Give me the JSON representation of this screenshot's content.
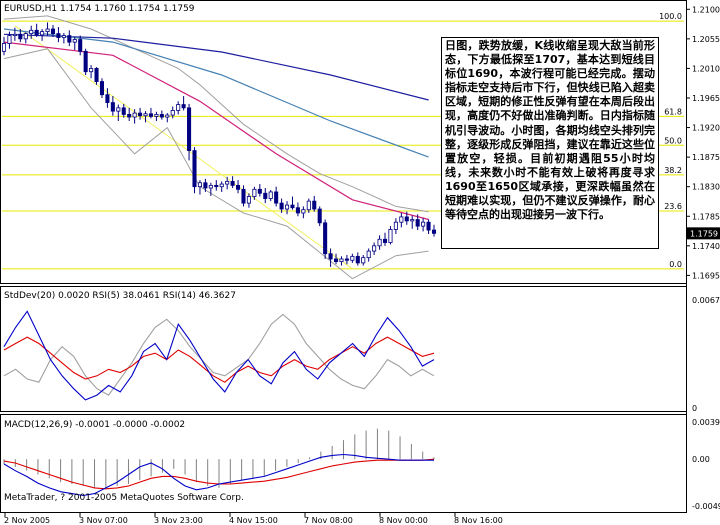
{
  "window": {
    "title": "EURUSD,H1  1.1754 1.1760 1.1754 1.1759",
    "copyright": "MetaTrader, ? 2001-2005 MetaQuotes Software Corp."
  },
  "colors": {
    "background": "#FFFFFF",
    "candle": "#000080",
    "ma_blue": "#1E1EA0",
    "ma_steel": "#4682B4",
    "ma_magenta": "#D0207A",
    "bollinger": "#A0A0A0",
    "fib": "#E8E800",
    "trendline": "#F0F060",
    "rsi5": "#0000C8",
    "rsi14": "#E00000",
    "macd_line": "#0000C8",
    "signal_line": "#E00000",
    "histogram": "#808080",
    "price_tag_bg": "#000000",
    "price_tag_fg": "#FFFFFF"
  },
  "commentary": "日图，跌势放缓，K线收缩呈现大敌当前形态，下方最低探至1707，基本达到短线目标位1690，本波行程可能已经完成。摆动指标走空支持后市下行，但快线已陷入超卖区域，短期的修正性反弹有望在本周后段出现，高度仍不好做出准确判断。日内指标随机引导波动。小时图，各期均线空头排列完整，逐级形成反弹阻挡，建议在靠近这些位置放空，轻损。目前初期遇阻55小时均线，未来数小时不能有效上破将再度寻求1690至1650区域承接，更深跌幅虽然在短期难以实现，但仍不建议反弹操作，耐心等待空点的出现迎接另一波下行。",
  "indicator_labels": {
    "stddev_rsi": "StdDev(20) 0.0020  RSI(5) 38.0461  RSI(14) 46.3627",
    "macd": "MACD(12,26,9) -0.0001 -0.0000 -0.0002"
  },
  "chart_data": {
    "type": "candlestick",
    "symbol": "EURUSD",
    "timeframe": "H1",
    "x_tick_labels": [
      "2 Nov 2005",
      "3 Nov 07:00",
      "3 Nov 23:00",
      "4 Nov 15:00",
      "7 Nov 08:00",
      "8 Nov 00:00",
      "8 Nov 16:00"
    ],
    "price_axis": {
      "ticks": [
        "1.2100",
        "1.2055",
        "1.2010",
        "1.1965",
        "1.1920",
        "1.1875",
        "1.1830",
        "1.1785",
        "1.1740",
        "1.1695"
      ],
      "ylim": [
        1.1688,
        1.2105
      ],
      "current_price": "1.1759"
    },
    "fibonacci": [
      {
        "label": "100.0",
        "price": 1.2082
      },
      {
        "label": "61.8",
        "price": 1.1937
      },
      {
        "label": "50.0",
        "price": 1.1893
      },
      {
        "label": "38.2",
        "price": 1.1848
      },
      {
        "label": "23.6",
        "price": 1.1793
      },
      {
        "label": "0.0",
        "price": 1.1705
      }
    ],
    "candles_ohlc": [
      [
        1.2036,
        1.2058,
        1.203,
        1.2048
      ],
      [
        1.2048,
        1.2066,
        1.204,
        1.206
      ],
      [
        1.206,
        1.2072,
        1.2052,
        1.2062
      ],
      [
        1.2062,
        1.207,
        1.205,
        1.2055
      ],
      [
        1.2055,
        1.2065,
        1.2048,
        1.2063
      ],
      [
        1.2063,
        1.2075,
        1.2055,
        1.2068
      ],
      [
        1.2068,
        1.2078,
        1.2058,
        1.2061
      ],
      [
        1.2061,
        1.207,
        1.2052,
        1.2066
      ],
      [
        1.2066,
        1.208,
        1.206,
        1.207
      ],
      [
        1.207,
        1.2076,
        1.2058,
        1.2063
      ],
      [
        1.2063,
        1.2073,
        1.205,
        1.2057
      ],
      [
        1.2057,
        1.2064,
        1.2048,
        1.206
      ],
      [
        1.206,
        1.2068,
        1.2044,
        1.205
      ],
      [
        1.205,
        1.2058,
        1.2038,
        1.2054
      ],
      [
        1.2054,
        1.206,
        1.203,
        1.2036
      ],
      [
        1.2036,
        1.204,
        1.2,
        1.2005
      ],
      [
        1.2005,
        1.2015,
        1.1995,
        1.201
      ],
      [
        1.201,
        1.2012,
        1.1985,
        1.199
      ],
      [
        1.199,
        1.1995,
        1.1965,
        1.197
      ],
      [
        1.197,
        1.198,
        1.195,
        1.1958
      ],
      [
        1.1958,
        1.1968,
        1.1938,
        1.1945
      ],
      [
        1.1945,
        1.1955,
        1.193,
        1.195
      ],
      [
        1.195,
        1.1956,
        1.1935,
        1.194
      ],
      [
        1.194,
        1.195,
        1.193,
        1.1936
      ],
      [
        1.1936,
        1.1948,
        1.1926,
        1.1942
      ],
      [
        1.1942,
        1.195,
        1.1932,
        1.1938
      ],
      [
        1.1938,
        1.1945,
        1.1928,
        1.1941
      ],
      [
        1.1941,
        1.195,
        1.1934,
        1.1937
      ],
      [
        1.1937,
        1.1944,
        1.193,
        1.194
      ],
      [
        1.194,
        1.1946,
        1.1932,
        1.1936
      ],
      [
        1.1936,
        1.1942,
        1.1928,
        1.1939
      ],
      [
        1.1939,
        1.1952,
        1.1934,
        1.1946
      ],
      [
        1.1946,
        1.196,
        1.194,
        1.1955
      ],
      [
        1.1955,
        1.1968,
        1.1946,
        1.195
      ],
      [
        1.195,
        1.1956,
        1.187,
        1.1885
      ],
      [
        1.1885,
        1.189,
        1.182,
        1.183
      ],
      [
        1.183,
        1.184,
        1.1818,
        1.1836
      ],
      [
        1.1836,
        1.1842,
        1.1822,
        1.1828
      ],
      [
        1.1828,
        1.1836,
        1.1816,
        1.1832
      ],
      [
        1.1832,
        1.184,
        1.1824,
        1.183
      ],
      [
        1.183,
        1.1838,
        1.1822,
        1.1834
      ],
      [
        1.1834,
        1.1845,
        1.1826,
        1.1838
      ],
      [
        1.1838,
        1.1846,
        1.1828,
        1.1832
      ],
      [
        1.1832,
        1.184,
        1.182,
        1.1826
      ],
      [
        1.1826,
        1.1832,
        1.18,
        1.1805
      ],
      [
        1.1805,
        1.182,
        1.1798,
        1.1815
      ],
      [
        1.1815,
        1.183,
        1.181,
        1.1826
      ],
      [
        1.1826,
        1.1834,
        1.1815,
        1.182
      ],
      [
        1.182,
        1.1828,
        1.1805,
        1.1812
      ],
      [
        1.1812,
        1.1825,
        1.1808,
        1.1822
      ],
      [
        1.1822,
        1.183,
        1.18,
        1.1805
      ],
      [
        1.1805,
        1.1812,
        1.179,
        1.1796
      ],
      [
        1.1796,
        1.1808,
        1.1788,
        1.1802
      ],
      [
        1.1802,
        1.1815,
        1.1795,
        1.1798
      ],
      [
        1.1798,
        1.1806,
        1.1785,
        1.179
      ],
      [
        1.179,
        1.18,
        1.1782,
        1.1795
      ],
      [
        1.1795,
        1.1812,
        1.179,
        1.1808
      ],
      [
        1.1808,
        1.1816,
        1.1792,
        1.1796
      ],
      [
        1.1796,
        1.18,
        1.177,
        1.1775
      ],
      [
        1.1775,
        1.178,
        1.172,
        1.1728
      ],
      [
        1.1728,
        1.1736,
        1.1708,
        1.172
      ],
      [
        1.172,
        1.1728,
        1.1712,
        1.1716
      ],
      [
        1.1716,
        1.1724,
        1.171,
        1.172
      ],
      [
        1.172,
        1.1726,
        1.1712,
        1.1718
      ],
      [
        1.1718,
        1.1728,
        1.1714,
        1.1724
      ],
      [
        1.1724,
        1.173,
        1.171,
        1.1714
      ],
      [
        1.1714,
        1.1726,
        1.171,
        1.1722
      ],
      [
        1.1722,
        1.1736,
        1.1716,
        1.1732
      ],
      [
        1.1732,
        1.1745,
        1.1726,
        1.174
      ],
      [
        1.174,
        1.1756,
        1.1734,
        1.175
      ],
      [
        1.175,
        1.176,
        1.174,
        1.1745
      ],
      [
        1.1745,
        1.177,
        1.1742,
        1.1765
      ],
      [
        1.1765,
        1.1782,
        1.1758,
        1.1776
      ],
      [
        1.1776,
        1.179,
        1.1768,
        1.1784
      ],
      [
        1.1784,
        1.1792,
        1.1772,
        1.1778
      ],
      [
        1.1778,
        1.1786,
        1.1766,
        1.178
      ],
      [
        1.178,
        1.1788,
        1.1764,
        1.177
      ],
      [
        1.177,
        1.1782,
        1.1762,
        1.1776
      ],
      [
        1.1776,
        1.178,
        1.1758,
        1.1764
      ],
      [
        1.1764,
        1.1772,
        1.1754,
        1.1759
      ]
    ],
    "moving_averages": [
      {
        "color": "ma_blue",
        "points": [
          [
            0,
            1.2062
          ],
          [
            20,
            1.2056
          ],
          [
            40,
            1.2035
          ],
          [
            60,
            1.2
          ],
          [
            78,
            1.1962
          ]
        ]
      },
      {
        "color": "ma_steel",
        "points": [
          [
            0,
            1.207
          ],
          [
            20,
            1.205
          ],
          [
            40,
            1.2
          ],
          [
            60,
            1.193
          ],
          [
            78,
            1.1875
          ]
        ]
      },
      {
        "color": "ma_magenta",
        "points": [
          [
            0,
            1.205
          ],
          [
            20,
            1.203
          ],
          [
            36,
            1.196
          ],
          [
            50,
            1.188
          ],
          [
            64,
            1.181
          ],
          [
            78,
            1.178
          ]
        ]
      }
    ],
    "bollinger": {
      "upper": [
        [
          0,
          1.2085
        ],
        [
          8,
          1.209
        ],
        [
          16,
          1.207
        ],
        [
          24,
          1.204
        ],
        [
          32,
          1.201
        ],
        [
          36,
          1.1985
        ],
        [
          44,
          1.1925
        ],
        [
          52,
          1.188
        ],
        [
          58,
          1.185
        ],
        [
          64,
          1.183
        ],
        [
          72,
          1.18
        ],
        [
          78,
          1.1792
        ]
      ],
      "lower": [
        [
          0,
          1.2025
        ],
        [
          8,
          1.204
        ],
        [
          16,
          1.195
        ],
        [
          24,
          1.188
        ],
        [
          30,
          1.192
        ],
        [
          36,
          1.183
        ],
        [
          44,
          1.179
        ],
        [
          52,
          1.177
        ],
        [
          58,
          1.173
        ],
        [
          64,
          1.169
        ],
        [
          72,
          1.1725
        ],
        [
          78,
          1.1732
        ]
      ]
    },
    "trendline": [
      [
        2,
        1.2075
      ],
      [
        64,
        1.1705
      ]
    ],
    "stddev_rsi_pane": {
      "ylim": [
        0,
        0.0067
      ],
      "ticks": [
        "0.0067",
        "0"
      ],
      "stddev": [
        0.002,
        0.0024,
        0.0018,
        0.0016,
        0.003,
        0.0038,
        0.0032,
        0.002,
        0.0012,
        0.0008,
        0.0018,
        0.0028,
        0.004,
        0.005,
        0.0055,
        0.0048,
        0.0038,
        0.003,
        0.0022,
        0.002,
        0.0025,
        0.003,
        0.004,
        0.0052,
        0.0058,
        0.0052,
        0.004,
        0.0032,
        0.0024,
        0.0018,
        0.0014,
        0.0012,
        0.002,
        0.003,
        0.0026,
        0.002,
        0.0024,
        0.002
      ],
      "rsi5": [
        0.0038,
        0.005,
        0.006,
        0.0045,
        0.003,
        0.002,
        0.0012,
        0.0005,
        0.0008,
        0.0014,
        0.001,
        0.002,
        0.0035,
        0.004,
        0.003,
        0.0052,
        0.0042,
        0.003,
        0.0018,
        0.001,
        0.0022,
        0.003,
        0.002,
        0.0015,
        0.0028,
        0.0035,
        0.0024,
        0.0018,
        0.0028,
        0.0034,
        0.004,
        0.0032,
        0.0045,
        0.0056,
        0.0048,
        0.0038,
        0.0026,
        0.003
      ],
      "rsi14": [
        0.0036,
        0.004,
        0.0044,
        0.004,
        0.0034,
        0.0028,
        0.0022,
        0.0018,
        0.002,
        0.0024,
        0.0022,
        0.0026,
        0.0032,
        0.0034,
        0.003,
        0.0036,
        0.0032,
        0.0026,
        0.002,
        0.0016,
        0.0022,
        0.0026,
        0.0022,
        0.002,
        0.0026,
        0.003,
        0.0026,
        0.0024,
        0.003,
        0.0034,
        0.0038,
        0.0034,
        0.004,
        0.0044,
        0.004,
        0.0036,
        0.0032,
        0.0034
      ]
    },
    "macd_pane": {
      "ticks": [
        "0.0039",
        "0.00",
        "-0.0049"
      ],
      "ylim": [
        -0.0049,
        0.0039
      ],
      "histogram": [
        -0.0005,
        -0.0008,
        -0.0012,
        -0.0016,
        -0.002,
        -0.0024,
        -0.0026,
        -0.0028,
        -0.003,
        -0.003,
        -0.0028,
        -0.0026,
        -0.0022,
        -0.0018,
        -0.0014,
        -0.001,
        -0.0016,
        -0.0024,
        -0.0028,
        -0.003,
        -0.0026,
        -0.0022,
        -0.002,
        -0.0018,
        -0.0012,
        -0.0008,
        -0.0004,
        0.0002,
        0.0008,
        0.0014,
        0.002,
        0.0026,
        0.003,
        0.0032,
        0.003,
        0.0024,
        0.0016,
        0.0008,
        0.0002
      ],
      "macd": [
        -0.0005,
        -0.0012,
        -0.0018,
        -0.0025,
        -0.003,
        -0.0034,
        -0.0036,
        -0.0038,
        -0.0036,
        -0.003,
        -0.0024,
        -0.0016,
        -0.0008,
        -0.0004,
        -0.001,
        -0.002,
        -0.0028,
        -0.0032,
        -0.003,
        -0.0026,
        -0.0024,
        -0.0022,
        -0.002,
        -0.0018,
        -0.0014,
        -0.001,
        -0.0006,
        -0.0002,
        0.0002,
        0.0004,
        0.0005,
        0.0004,
        0.0002,
        0.0001,
        0.0,
        -0.0001,
        -0.0001,
        -0.0001,
        -0.0001
      ],
      "signal": [
        -0.0002,
        -0.0004,
        -0.0008,
        -0.0012,
        -0.0016,
        -0.002,
        -0.0024,
        -0.0027,
        -0.003,
        -0.0031,
        -0.003,
        -0.0028,
        -0.0024,
        -0.002,
        -0.0018,
        -0.0018,
        -0.002,
        -0.0023,
        -0.0025,
        -0.0026,
        -0.0026,
        -0.0025,
        -0.0024,
        -0.0023,
        -0.0021,
        -0.0019,
        -0.0016,
        -0.0013,
        -0.001,
        -0.0007,
        -0.0005,
        -0.0003,
        -0.0002,
        -0.0001,
        -0.0001,
        -0.0001,
        -0.0001,
        -0.0001,
        0.0
      ]
    }
  }
}
